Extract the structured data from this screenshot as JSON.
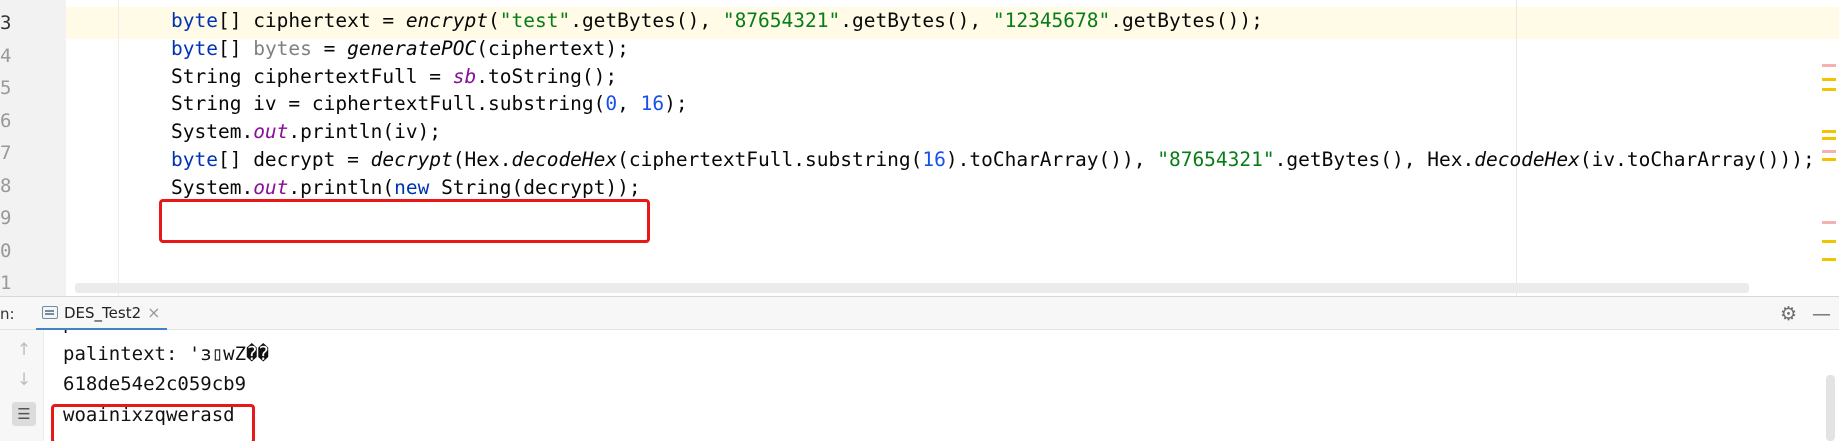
{
  "editor": {
    "line_numbers": [
      "3",
      "4",
      "5",
      "6",
      "7",
      "8",
      "9",
      "0",
      "1"
    ],
    "lines": [
      [
        {
          "t": "byte",
          "c": "kw"
        },
        {
          "t": "[] ciphertext = "
        },
        {
          "t": "encrypt",
          "c": "it"
        },
        {
          "t": "("
        },
        {
          "t": "\"test\"",
          "c": "str"
        },
        {
          "t": ".getBytes(), "
        },
        {
          "t": "\"87654321\"",
          "c": "str"
        },
        {
          "t": ".getBytes(), "
        },
        {
          "t": "\"12345678\"",
          "c": "str"
        },
        {
          "t": ".getBytes());"
        }
      ],
      [
        {
          "t": "byte",
          "c": "kw"
        },
        {
          "t": "[] "
        },
        {
          "t": "bytes",
          "c": "unused"
        },
        {
          "t": " = "
        },
        {
          "t": "generatePOC",
          "c": "it"
        },
        {
          "t": "(ciphertext);"
        }
      ],
      [
        {
          "t": "String ciphertextFull = "
        },
        {
          "t": "sb",
          "c": "fld"
        },
        {
          "t": ".toString();"
        }
      ],
      [
        {
          "t": "String iv = ciphertextFull.substring("
        },
        {
          "t": "0",
          "c": "num"
        },
        {
          "t": ", "
        },
        {
          "t": "16",
          "c": "num"
        },
        {
          "t": ");"
        }
      ],
      [
        {
          "t": "System."
        },
        {
          "t": "out",
          "c": "fld"
        },
        {
          "t": ".println(iv);"
        }
      ],
      [
        {
          "t": "byte",
          "c": "kw"
        },
        {
          "t": "[] decrypt = "
        },
        {
          "t": "decrypt",
          "c": "it"
        },
        {
          "t": "(Hex."
        },
        {
          "t": "decodeHex",
          "c": "it"
        },
        {
          "t": "(ciphertextFull.substring("
        },
        {
          "t": "16",
          "c": "num"
        },
        {
          "t": ").toCharArray()), "
        },
        {
          "t": "\"87654321\"",
          "c": "str"
        },
        {
          "t": ".getBytes(), Hex."
        },
        {
          "t": "decodeHex",
          "c": "it"
        },
        {
          "t": "(iv.toCharArray()));"
        }
      ],
      [
        {
          "t": "System."
        },
        {
          "t": "out",
          "c": "fld"
        },
        {
          "t": ".println("
        },
        {
          "t": "new",
          "c": "kw"
        },
        {
          "t": " String(decrypt));"
        }
      ]
    ]
  },
  "run_panel": {
    "label": "n:",
    "tab_label": "DES_Test2",
    "tab_close": "×",
    "settings_icon": "gear-icon",
    "minimize_icon": "minimize-icon"
  },
  "console": {
    "lines": [
      "palintext: test▯▯▯▯",
      "palintext: 'з▯wZ��",
      "618de54e2c059cb9",
      "woainixzqwerasd"
    ]
  },
  "colors": {
    "highlight_box": "#e81818",
    "keyword": "#0033b3",
    "string": "#067d17",
    "number": "#1750eb",
    "field": "#871094"
  }
}
